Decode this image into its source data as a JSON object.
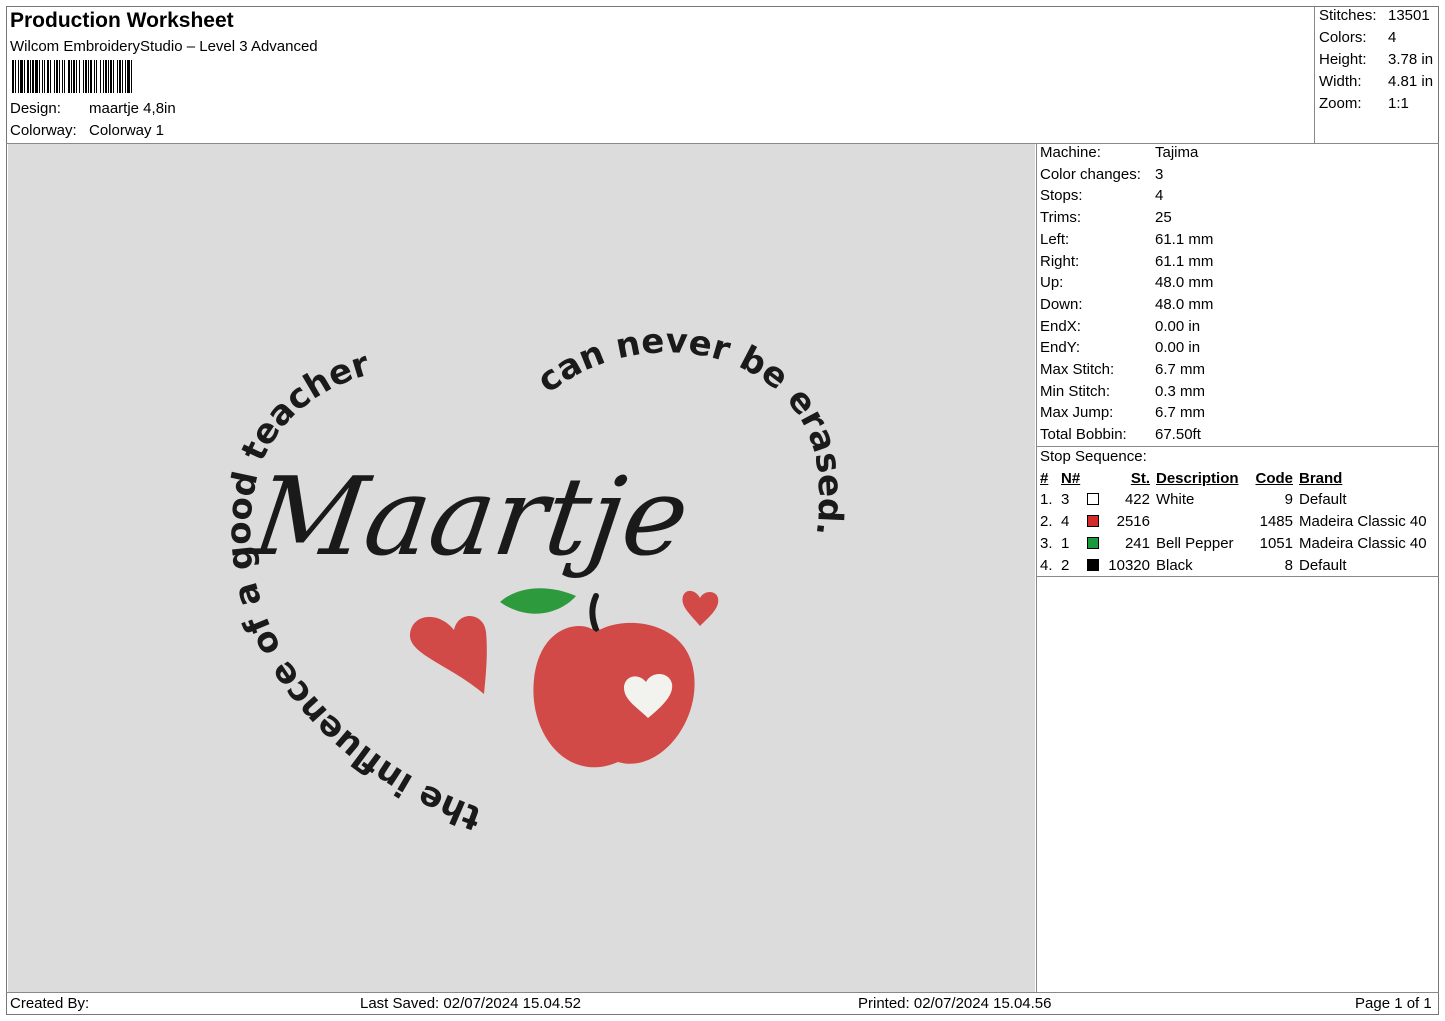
{
  "header": {
    "title": "Production Worksheet",
    "software": "Wilcom EmbroideryStudio – Level 3 Advanced",
    "design_label": "Design:",
    "design_value": "maartje 4,8in",
    "colorway_label": "Colorway:",
    "colorway_value": "Colorway 1"
  },
  "summary": {
    "stitches_label": "Stitches:",
    "stitches_value": "13501",
    "colors_label": "Colors:",
    "colors_value": "4",
    "height_label": "Height:",
    "height_value": "3.78 in",
    "width_label": "Width:",
    "width_value": "4.81 in",
    "zoom_label": "Zoom:",
    "zoom_value": "1:1"
  },
  "machine_info": [
    {
      "label": "Machine:",
      "value": "Tajima"
    },
    {
      "label": "Color changes:",
      "value": "3"
    },
    {
      "label": "Stops:",
      "value": "4"
    },
    {
      "label": "Trims:",
      "value": "25"
    },
    {
      "label": "Left:",
      "value": "61.1 mm"
    },
    {
      "label": "Right:",
      "value": "61.1 mm"
    },
    {
      "label": "Up:",
      "value": "48.0 mm"
    },
    {
      "label": "Down:",
      "value": "48.0 mm"
    },
    {
      "label": "EndX:",
      "value": "0.00 in"
    },
    {
      "label": "EndY:",
      "value": "0.00 in"
    },
    {
      "label": "Max Stitch:",
      "value": "6.7 mm"
    },
    {
      "label": "Min Stitch:",
      "value": "0.3 mm"
    },
    {
      "label": "Max Jump:",
      "value": "6.7 mm"
    },
    {
      "label": "Total Bobbin:",
      "value": "67.50ft"
    }
  ],
  "stop_sequence": {
    "title": "Stop Sequence:",
    "headers": {
      "num": "#",
      "n": "N#",
      "st": "St.",
      "desc": "Description",
      "code": "Code",
      "brand": "Brand"
    },
    "rows": [
      {
        "num": "1.",
        "n": "3",
        "color": "#ffffff",
        "st": "422",
        "desc": "White",
        "code": "9",
        "brand": "Default"
      },
      {
        "num": "2.",
        "n": "4",
        "color": "#d42a2a",
        "st": "2516",
        "desc": "",
        "code": "1485",
        "brand": "Madeira Classic 40"
      },
      {
        "num": "3.",
        "n": "1",
        "color": "#1a9a3a",
        "st": "241",
        "desc": "Bell Pepper",
        "code": "1051",
        "brand": "Madeira Classic 40"
      },
      {
        "num": "4.",
        "n": "2",
        "color": "#000000",
        "st": "10320",
        "desc": "Black",
        "code": "8",
        "brand": "Default"
      }
    ]
  },
  "design": {
    "name_text": "Maartje",
    "arc_left_text": "the influence of a good teacher",
    "arc_right_text": "can never be erased.",
    "colors": {
      "thread_black": "#1a1a1a",
      "apple_red": "#d24a48",
      "leaf_green": "#2e9a3e",
      "heart_white": "#f2f2ee",
      "canvas": "#dcdcdc"
    }
  },
  "footer": {
    "created_by": "Created By:",
    "last_saved": "Last Saved: 02/07/2024 15.04.52",
    "printed": "Printed: 02/07/2024 15.04.56",
    "page": "Page 1 of 1"
  }
}
